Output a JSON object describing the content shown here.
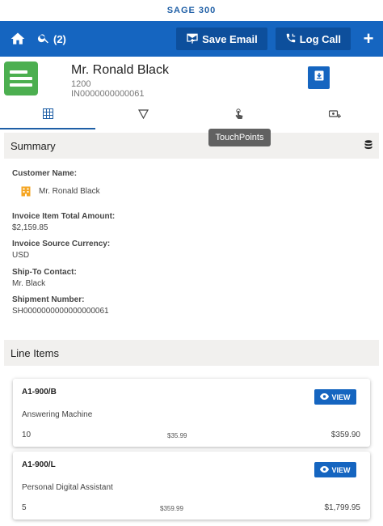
{
  "brand": {
    "title": "SAGE 300"
  },
  "toolbar": {
    "search_count": "(2)",
    "save_email_label": "Save Email",
    "log_call_label": "Log Call"
  },
  "header": {
    "name": "Mr. Ronald Black",
    "number": "1200",
    "invoice_id": "IN0000000000061"
  },
  "tabs": [
    {
      "icon": "grid-icon"
    },
    {
      "icon": "filter-icon"
    },
    {
      "icon": "touch-icon"
    },
    {
      "icon": "add-card-icon"
    }
  ],
  "tooltip": {
    "text": "TouchPoints"
  },
  "summary": {
    "title": "Summary",
    "customer_name_label": "Customer Name:",
    "customer_name": "Mr. Ronald Black",
    "total_amount_label": "Invoice Item Total Amount:",
    "total_amount": "$2,159.85",
    "currency_label": "Invoice Source Currency:",
    "currency": "USD",
    "ship_to_label": "Ship-To Contact:",
    "ship_to": "Mr. Black",
    "shipment_label": "Shipment Number:",
    "shipment": "SH0000000000000000061"
  },
  "line_items": {
    "title": "Line Items",
    "view_label": "VIEW",
    "items": [
      {
        "code": "A1-900/B",
        "description": "Answering Machine",
        "qty": "10",
        "unit_price": "$35.99",
        "total": "$359.90"
      },
      {
        "code": "A1-900/L",
        "description": "Personal Digital Assistant",
        "qty": "5",
        "unit_price": "$359.99",
        "total": "$1,799.95"
      }
    ]
  },
  "colors": {
    "primary": "#1565c0",
    "brand_text": "#1f5fa6",
    "doc_icon": "#4caf50",
    "building_icon": "#f5a623"
  }
}
